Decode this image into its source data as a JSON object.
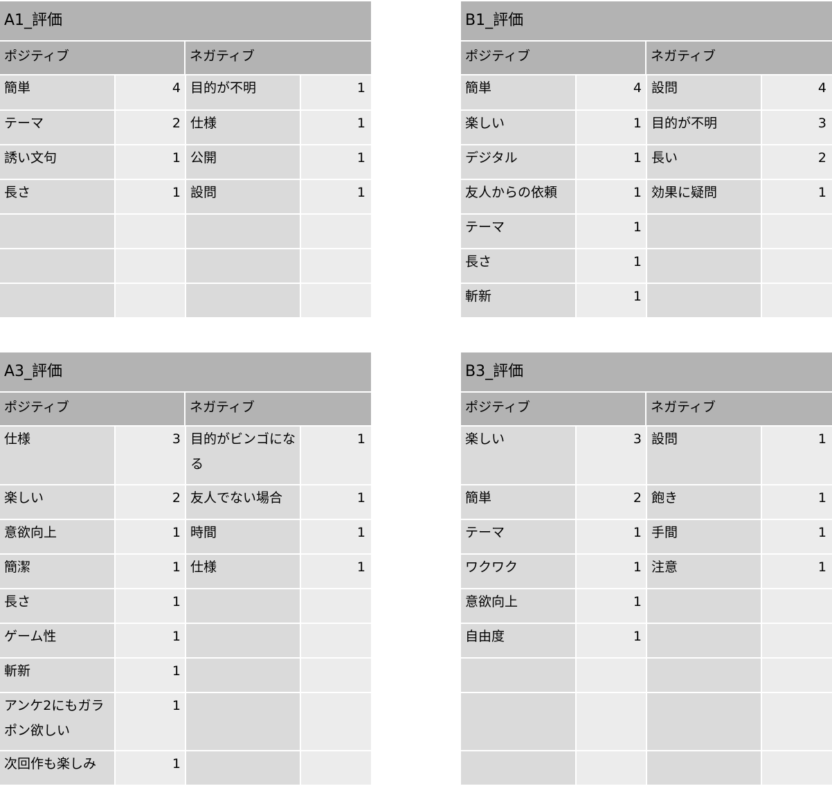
{
  "panels": {
    "a1": {
      "title": "A1_評価",
      "positive_header": "ポジティブ",
      "negative_header": "ネガティブ",
      "rows": [
        {
          "pos_label": "簡単",
          "pos_count": "4",
          "neg_label": "目的が不明",
          "neg_count": "1"
        },
        {
          "pos_label": "テーマ",
          "pos_count": "2",
          "neg_label": "仕様",
          "neg_count": "1"
        },
        {
          "pos_label": "誘い文句",
          "pos_count": "1",
          "neg_label": "公開",
          "neg_count": "1"
        },
        {
          "pos_label": "長さ",
          "pos_count": "1",
          "neg_label": "設問",
          "neg_count": "1"
        },
        {
          "pos_label": "",
          "pos_count": "",
          "neg_label": "",
          "neg_count": ""
        },
        {
          "pos_label": "",
          "pos_count": "",
          "neg_label": "",
          "neg_count": ""
        },
        {
          "pos_label": "",
          "pos_count": "",
          "neg_label": "",
          "neg_count": ""
        }
      ]
    },
    "b1": {
      "title": "B1_評価",
      "positive_header": "ポジティブ",
      "negative_header": "ネガティブ",
      "rows": [
        {
          "pos_label": "簡単",
          "pos_count": "4",
          "neg_label": "設問",
          "neg_count": "4"
        },
        {
          "pos_label": "楽しい",
          "pos_count": "1",
          "neg_label": "目的が不明",
          "neg_count": "3"
        },
        {
          "pos_label": "デジタル",
          "pos_count": "1",
          "neg_label": "長い",
          "neg_count": "2"
        },
        {
          "pos_label": "友人からの依頼",
          "pos_count": "1",
          "neg_label": "効果に疑問",
          "neg_count": "1"
        },
        {
          "pos_label": "テーマ",
          "pos_count": "1",
          "neg_label": "",
          "neg_count": ""
        },
        {
          "pos_label": "長さ",
          "pos_count": "1",
          "neg_label": "",
          "neg_count": ""
        },
        {
          "pos_label": "斬新",
          "pos_count": "1",
          "neg_label": "",
          "neg_count": ""
        }
      ]
    },
    "a3": {
      "title": "A3_評価",
      "positive_header": "ポジティブ",
      "negative_header": "ネガティブ",
      "rows": [
        {
          "pos_label": "仕様",
          "pos_count": "3",
          "neg_label": "目的がビンゴになる",
          "neg_count": "1",
          "tall": true
        },
        {
          "pos_label": "楽しい",
          "pos_count": "2",
          "neg_label": "友人でない場合",
          "neg_count": "1"
        },
        {
          "pos_label": "意欲向上",
          "pos_count": "1",
          "neg_label": "時間",
          "neg_count": "1"
        },
        {
          "pos_label": "簡潔",
          "pos_count": "1",
          "neg_label": "仕様",
          "neg_count": "1"
        },
        {
          "pos_label": "長さ",
          "pos_count": "1",
          "neg_label": "",
          "neg_count": ""
        },
        {
          "pos_label": "ゲーム性",
          "pos_count": "1",
          "neg_label": "",
          "neg_count": ""
        },
        {
          "pos_label": "斬新",
          "pos_count": "1",
          "neg_label": "",
          "neg_count": ""
        },
        {
          "pos_label": "アンケ2にもガラポン欲しい",
          "pos_count": "1",
          "neg_label": "",
          "neg_count": "",
          "tall": true
        },
        {
          "pos_label": "次回作も楽しみ",
          "pos_count": "1",
          "neg_label": "",
          "neg_count": ""
        }
      ]
    },
    "b3": {
      "title": "B3_評価",
      "positive_header": "ポジティブ",
      "negative_header": "ネガティブ",
      "rows": [
        {
          "pos_label": "楽しい",
          "pos_count": "3",
          "neg_label": "設問",
          "neg_count": "1",
          "tall": true
        },
        {
          "pos_label": "簡単",
          "pos_count": "2",
          "neg_label": "飽き",
          "neg_count": "1"
        },
        {
          "pos_label": "テーマ",
          "pos_count": "1",
          "neg_label": "手間",
          "neg_count": "1"
        },
        {
          "pos_label": "ワクワク",
          "pos_count": "1",
          "neg_label": "注意",
          "neg_count": "1"
        },
        {
          "pos_label": "意欲向上",
          "pos_count": "1",
          "neg_label": "",
          "neg_count": ""
        },
        {
          "pos_label": "自由度",
          "pos_count": "1",
          "neg_label": "",
          "neg_count": ""
        },
        {
          "pos_label": "",
          "pos_count": "",
          "neg_label": "",
          "neg_count": ""
        },
        {
          "pos_label": "",
          "pos_count": "",
          "neg_label": "",
          "neg_count": "",
          "tall": true
        },
        {
          "pos_label": "",
          "pos_count": "",
          "neg_label": "",
          "neg_count": ""
        }
      ]
    }
  }
}
